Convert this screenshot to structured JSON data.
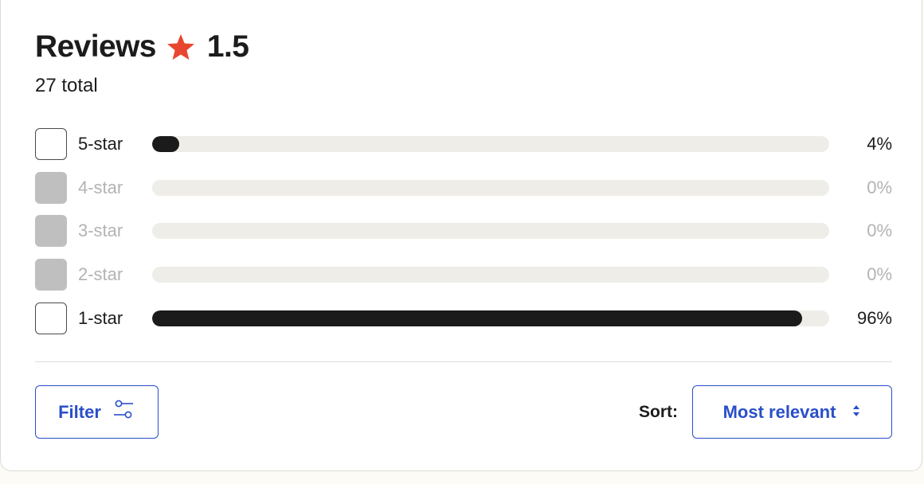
{
  "reviews": {
    "title": "Reviews",
    "rating": "1.5",
    "total_text": "27 total",
    "star_color": "#e8472f"
  },
  "breakdown": [
    {
      "label": "5-star",
      "percent_text": "4%",
      "percent": 4,
      "enabled": true
    },
    {
      "label": "4-star",
      "percent_text": "0%",
      "percent": 0,
      "enabled": false
    },
    {
      "label": "3-star",
      "percent_text": "0%",
      "percent": 0,
      "enabled": false
    },
    {
      "label": "2-star",
      "percent_text": "0%",
      "percent": 0,
      "enabled": false
    },
    {
      "label": "1-star",
      "percent_text": "96%",
      "percent": 96,
      "enabled": true
    }
  ],
  "toolbar": {
    "filter_label": "Filter",
    "filter_icon": "filter-sliders-icon",
    "sort_label": "Sort:",
    "sort_value": "Most relevant",
    "sort_icon": "up-down-arrows-icon"
  },
  "colors": {
    "accent": "#2a4fc9",
    "bar_fill": "#1b1b1b",
    "bar_track": "#efede7"
  }
}
